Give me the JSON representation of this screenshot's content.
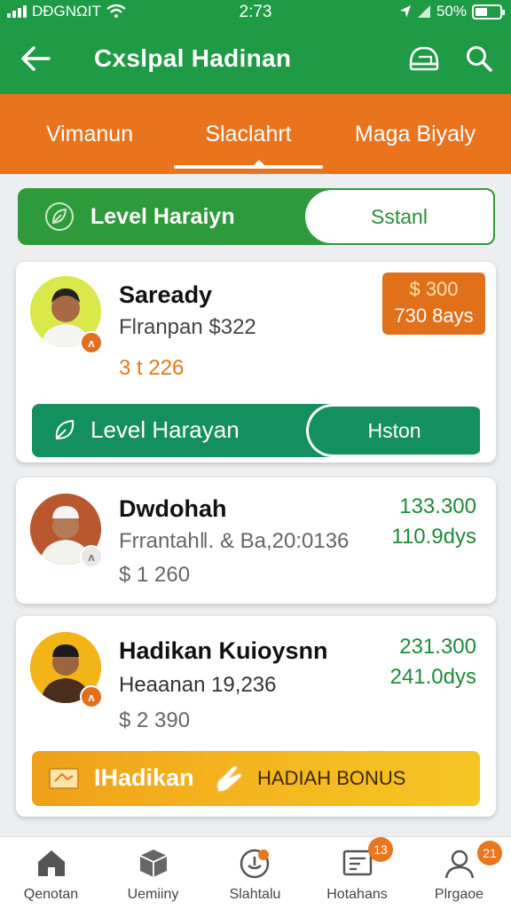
{
  "status_bar": {
    "carrier": "DÐGNΩIT",
    "time": "2:73",
    "battery": "50%",
    "battery_level": 0.5
  },
  "header": {
    "title": "Cxslpal Hadinan",
    "back_icon": "arrow-left-icon",
    "icons": [
      "helmet-icon",
      "search-icon"
    ]
  },
  "tabs": [
    {
      "label": "Vimanun",
      "active": false
    },
    {
      "label": "Slaclahrt",
      "active": true
    },
    {
      "label": "Maga Biyaly",
      "active": false
    }
  ],
  "level_toggle": {
    "label": "Level Haraiyn",
    "pill": "Sstanl",
    "icon": "leaf-icon"
  },
  "cards": [
    {
      "name": "Saready",
      "subtitle": "Flranpan $322",
      "amount": "3 t 226",
      "badge_lines": [
        "$ 300",
        "730 8ays"
      ],
      "action": {
        "label": "Level Harayan",
        "pill": "Hston",
        "icon": "leaf-icon"
      }
    },
    {
      "name": "Dwdohah",
      "subtitle": "Frrantahǁ. & Ba,20:0136",
      "amount": "$ 1 260",
      "right_lines": [
        "133.300",
        "110.9dys"
      ]
    },
    {
      "name": "Hadikan Kuioysnn",
      "subtitle": "Heaanan 19,236",
      "amount": "$ 2 390",
      "right_lines": [
        "231.300",
        "241.0dys"
      ],
      "bonus": {
        "label": "IHadikan",
        "label2": "HADIAH BONUS",
        "icons": [
          "ticket-icon",
          "hand-icon"
        ]
      }
    }
  ],
  "bottom_nav": [
    {
      "label": "Qenotan",
      "icon": "home-icon",
      "badge": ""
    },
    {
      "label": "Uemiiny",
      "icon": "box-icon",
      "badge": ""
    },
    {
      "label": "Slahtalu",
      "icon": "gift-icon",
      "badge": ""
    },
    {
      "label": "Hotahans",
      "icon": "receipt-icon",
      "badge": "13"
    },
    {
      "label": "Plrgaoe",
      "icon": "profile-icon",
      "badge": "21"
    }
  ],
  "colors": {
    "primary_green": "#1f9a45",
    "tab_orange": "#ea741d",
    "teal": "#14905f",
    "gold": "#f4b21e"
  }
}
